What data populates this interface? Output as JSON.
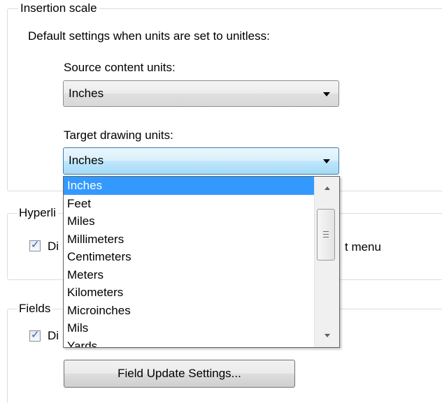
{
  "insertion_scale": {
    "group_title": "Insertion scale",
    "description": "Default settings when units are set to unitless:",
    "source_label": "Source content units:",
    "source_value": "Inches",
    "target_label": "Target drawing units:",
    "target_value": "Inches"
  },
  "dropdown": {
    "selected": "Inches",
    "options": [
      "Inches",
      "Feet",
      "Miles",
      "Millimeters",
      "Centimeters",
      "Meters",
      "Kilometers",
      "Microinches",
      "Mils",
      "Yards"
    ]
  },
  "hyperlink": {
    "group_title_visible": "Hyperli",
    "checkbox_text_visible_left": "Di",
    "checkbox_text_visible_right": "t menu",
    "checked": true
  },
  "fields": {
    "group_title": "Fields",
    "checkbox_text_visible_left": "Di",
    "checked": true,
    "button_label": "Field Update Settings..."
  },
  "icons": {
    "combo_arrow": "chevron-down-icon",
    "check": "checkmark-icon",
    "scroll_up": "scroll-up-icon",
    "scroll_down": "scroll-down-icon"
  },
  "colors": {
    "selection": "#3399ff",
    "group_border": "#d5dfe5",
    "focused_border": "#3c7fb1"
  }
}
